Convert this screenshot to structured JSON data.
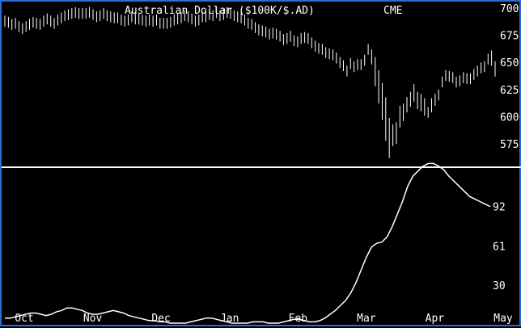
{
  "chart_data": [
    {
      "type": "bar",
      "subtype": "ohlc",
      "title": "Australian Dollar ($100K/$.AD)",
      "exchange": "CME",
      "ylim": [
        555,
        700
      ],
      "yticks": [
        575,
        600,
        625,
        650,
        675,
        700
      ],
      "x_categories": [
        "Oct",
        "Nov",
        "Dec",
        "Jan",
        "Feb",
        "Mar",
        "Apr",
        "May"
      ],
      "series": [
        {
          "values_hilo": [
            [
              693,
              683
            ],
            [
              692,
              682
            ],
            [
              690,
              680
            ],
            [
              691,
              681
            ],
            [
              688,
              678
            ],
            [
              686,
              676
            ],
            [
              688,
              678
            ],
            [
              690,
              680
            ],
            [
              692,
              682
            ],
            [
              691,
              681
            ],
            [
              690,
              680
            ],
            [
              693,
              683
            ],
            [
              695,
              685
            ],
            [
              693,
              683
            ],
            [
              691,
              681
            ],
            [
              694,
              684
            ],
            [
              696,
              686
            ],
            [
              698,
              688
            ],
            [
              699,
              689
            ],
            [
              700,
              690
            ],
            [
              701,
              691
            ],
            [
              700,
              690
            ],
            [
              700,
              690
            ],
            [
              700,
              690
            ],
            [
              701,
              691
            ],
            [
              699,
              689
            ],
            [
              697,
              687
            ],
            [
              698,
              688
            ],
            [
              700,
              690
            ],
            [
              698,
              688
            ],
            [
              697,
              687
            ],
            [
              696,
              686
            ],
            [
              696,
              686
            ],
            [
              694,
              684
            ],
            [
              693,
              683
            ],
            [
              694,
              684
            ],
            [
              697,
              687
            ],
            [
              695,
              685
            ],
            [
              695,
              685
            ],
            [
              694,
              684
            ],
            [
              693,
              683
            ],
            [
              694,
              684
            ],
            [
              693,
              683
            ],
            [
              694,
              684
            ],
            [
              691,
              681
            ],
            [
              691,
              681
            ],
            [
              691,
              681
            ],
            [
              692,
              682
            ],
            [
              694,
              684
            ],
            [
              695,
              685
            ],
            [
              696,
              686
            ],
            [
              698,
              688
            ],
            [
              697,
              687
            ],
            [
              695,
              685
            ],
            [
              693,
              683
            ],
            [
              694,
              684
            ],
            [
              697,
              687
            ],
            [
              697,
              687
            ],
            [
              699,
              689
            ],
            [
              698,
              688
            ],
            [
              701,
              691
            ],
            [
              698,
              688
            ],
            [
              699,
              689
            ],
            [
              701,
              691
            ],
            [
              700,
              690
            ],
            [
              698,
              688
            ],
            [
              697,
              687
            ],
            [
              696,
              686
            ],
            [
              694,
              684
            ],
            [
              691,
              681
            ],
            [
              690,
              680
            ],
            [
              687,
              677
            ],
            [
              685,
              675
            ],
            [
              684,
              674
            ],
            [
              683,
              673
            ],
            [
              681,
              671
            ],
            [
              682,
              672
            ],
            [
              681,
              671
            ],
            [
              679,
              669
            ],
            [
              676,
              666
            ],
            [
              677,
              667
            ],
            [
              679,
              669
            ],
            [
              675,
              665
            ],
            [
              674,
              664
            ],
            [
              677,
              667
            ],
            [
              678,
              668
            ],
            [
              677,
              667
            ],
            [
              673,
              663
            ],
            [
              670,
              660
            ],
            [
              668,
              658
            ],
            [
              667,
              657
            ],
            [
              664,
              654
            ],
            [
              663,
              653
            ],
            [
              662,
              652
            ],
            [
              659,
              649
            ],
            [
              655,
              645
            ],
            [
              652,
              642
            ],
            [
              647,
              637
            ],
            [
              654,
              644
            ],
            [
              651,
              641
            ],
            [
              653,
              643
            ],
            [
              653,
              643
            ],
            [
              657,
              647
            ],
            [
              667,
              657
            ],
            [
              662,
              648
            ],
            [
              655,
              628
            ],
            [
              643,
              612
            ],
            [
              631,
              597
            ],
            [
              618,
              578
            ],
            [
              599,
              562
            ],
            [
              593,
              573
            ],
            [
              595,
              575
            ],
            [
              610,
              590
            ],
            [
              612,
              596
            ],
            [
              618,
              604
            ],
            [
              623,
              609
            ],
            [
              630,
              614
            ],
            [
              623,
              607
            ],
            [
              621,
              605
            ],
            [
              617,
              601
            ],
            [
              609,
              599
            ],
            [
              617,
              604
            ],
            [
              621,
              610
            ],
            [
              625,
              615
            ],
            [
              637,
              627
            ],
            [
              643,
              633
            ],
            [
              642,
              632
            ],
            [
              641,
              631
            ],
            [
              637,
              627
            ],
            [
              638,
              628
            ],
            [
              641,
              631
            ],
            [
              640,
              630
            ],
            [
              640,
              630
            ],
            [
              644,
              634
            ],
            [
              647,
              637
            ],
            [
              650,
              640
            ],
            [
              651,
              641
            ],
            [
              658,
              648
            ],
            [
              661,
              647
            ],
            [
              651,
              637
            ]
          ]
        }
      ]
    },
    {
      "type": "line",
      "ylim": [
        0,
        125
      ],
      "yticks": [
        30,
        61,
        92
      ],
      "x_categories": [
        "Oct",
        "Nov",
        "Dec",
        "Jan",
        "Feb",
        "Mar",
        "Apr",
        "May"
      ],
      "series": [
        {
          "values": [
            4,
            4,
            5,
            6,
            7,
            8,
            8,
            7,
            6,
            7,
            9,
            10,
            12,
            12,
            11,
            10,
            8,
            7,
            7,
            8,
            9,
            10,
            9,
            8,
            6,
            5,
            4,
            3,
            2,
            2,
            1,
            1,
            0,
            0,
            0,
            0,
            1,
            2,
            3,
            4,
            4,
            3,
            2,
            1,
            0,
            0,
            0,
            0,
            1,
            1,
            1,
            0,
            0,
            0,
            1,
            2,
            3,
            3,
            2,
            1,
            1,
            2,
            4,
            7,
            10,
            14,
            18,
            24,
            32,
            42,
            52,
            60,
            63,
            64,
            68,
            76,
            86,
            96,
            108,
            116,
            120,
            124,
            126,
            126,
            124,
            121,
            116,
            112,
            108,
            104,
            100,
            98,
            96,
            94,
            92
          ]
        }
      ]
    }
  ]
}
